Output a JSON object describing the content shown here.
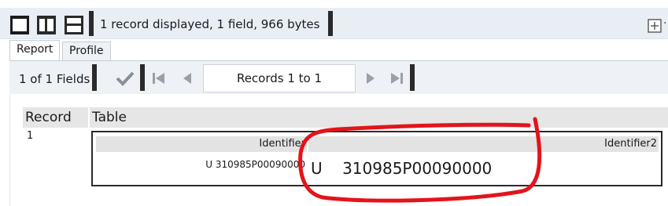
{
  "toolbar": {
    "status_text": "1 record displayed, 1 field, 966 bytes",
    "view_buttons": [
      "single-view-icon",
      "split-columns-icon",
      "split-rows-icon"
    ],
    "expand_icon": "expand-plus-icon",
    "trailing_char": "·"
  },
  "tabs": [
    {
      "label": "Report",
      "active": true
    },
    {
      "label": "Profile",
      "active": false
    }
  ],
  "navigation": {
    "fields_count": "1 of 1 Fields",
    "records_label": "Records 1 to 1",
    "icons": [
      "checkmark-icon",
      "first-page-icon",
      "previous-icon",
      "next-icon",
      "last-page-icon"
    ]
  },
  "table": {
    "columns": [
      "Record",
      "Table"
    ],
    "rows": [
      {
        "record": "1",
        "inner_headers": [
          "Identifier",
          "Identifier2"
        ],
        "identifier": "U 310985P00090000",
        "identifier2": "U    310985P00090000"
      }
    ]
  },
  "colors": {
    "toolbar_bg": "#e9eef5",
    "annotation": "#e3141b"
  }
}
